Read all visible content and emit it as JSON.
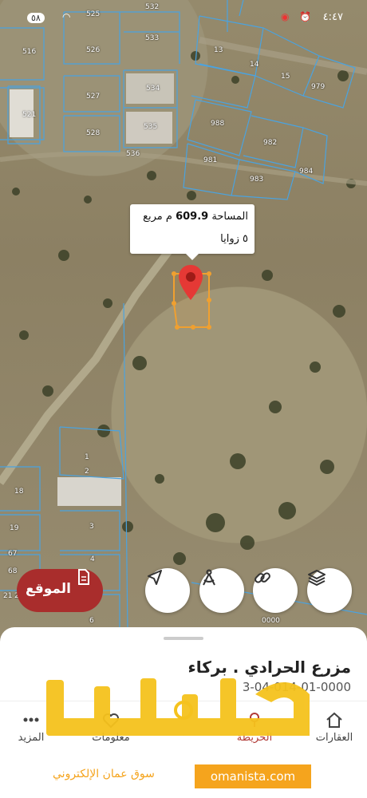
{
  "status_bar": {
    "time": "٤:٤٧",
    "battery": "٥٨"
  },
  "map": {
    "plot_numbers": [
      {
        "label": "516"
      },
      {
        "label": "525"
      },
      {
        "label": "532"
      },
      {
        "label": "533"
      },
      {
        "label": "526"
      },
      {
        "label": "527"
      },
      {
        "label": "534"
      },
      {
        "label": "528"
      },
      {
        "label": "535"
      },
      {
        "label": "536"
      },
      {
        "label": "521"
      },
      {
        "label": "13"
      },
      {
        "label": "14"
      },
      {
        "label": "15"
      },
      {
        "label": "979"
      },
      {
        "label": "988"
      },
      {
        "label": "982"
      },
      {
        "label": "981"
      },
      {
        "label": "984"
      },
      {
        "label": "983"
      },
      {
        "label": "1"
      },
      {
        "label": "2"
      },
      {
        "label": "18"
      },
      {
        "label": "3"
      },
      {
        "label": "19"
      },
      {
        "label": "67"
      },
      {
        "label": "68"
      },
      {
        "label": "4"
      },
      {
        "label": "20"
      },
      {
        "label": "21"
      },
      {
        "label": "5"
      },
      {
        "label": "6"
      },
      {
        "label": "0000"
      }
    ],
    "tooltip": {
      "area_prefix": "المساحة",
      "area_value": "609.9",
      "area_unit": "م مربع",
      "corners": "٥ زوايا"
    },
    "buttons": {
      "location_label": "الموقع",
      "layers_icon": "layers-icon",
      "link_icon": "link-icon",
      "measure_icon": "compass-icon",
      "navigate_icon": "navigation-arrow-icon"
    }
  },
  "parcel": {
    "title": "مزرع الحرادي . بركاء",
    "id": "3-04-014-01-0000"
  },
  "nav": {
    "items": [
      {
        "label": "العقارات",
        "icon": "home-icon"
      },
      {
        "label": "الخريطة",
        "icon": "map-icon"
      },
      {
        "label": "معلومات",
        "icon": "info-icon"
      },
      {
        "label": "المزيد",
        "icon": "more-icon"
      }
    ]
  },
  "watermark": {
    "brand": "عمانيستا",
    "site": "omanista.com",
    "caption": "سوق عمان الإلكتروني"
  },
  "colors": {
    "accent": "#a92d2c",
    "parcel_outline": "#f0a030",
    "plot_lines": "#4aa3e0",
    "watermark": "#f5a41d"
  }
}
